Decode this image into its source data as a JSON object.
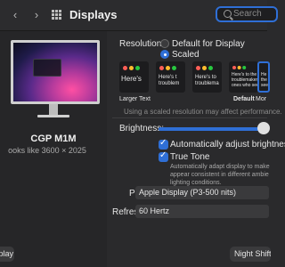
{
  "window": {
    "title": "Displays"
  },
  "toolbar": {
    "back": "‹",
    "forward": "›",
    "search_placeholder": "Search"
  },
  "display": {
    "name": "CGP M1M",
    "resolution_note": "ooks like 3600 × 2025",
    "left_button": "splay"
  },
  "resolution": {
    "label": "Resolution:",
    "option_default": "Default for Display",
    "option_scaled": "Scaled",
    "selected": "Scaled",
    "scales": [
      {
        "text": "Here's",
        "caption": "Larger Text",
        "selected": false
      },
      {
        "text": "Here's t\ntroublem",
        "caption": "",
        "selected": false
      },
      {
        "text": "Here's to\ntroublema",
        "caption": "",
        "selected": false
      },
      {
        "text": "Here's to the\ntroublemaker\nones who see",
        "caption": "Default",
        "selected": false
      },
      {
        "text": "He\nthe\nsee",
        "caption": "Mor",
        "selected": true
      }
    ],
    "note": "Using a scaled resolution may affect performance."
  },
  "brightness": {
    "label": "Brightness:",
    "level": 0.97
  },
  "auto_brightness": {
    "label": "Automatically adjust brightness",
    "checked": true
  },
  "true_tone": {
    "label": "True Tone",
    "checked": true,
    "desc": [
      "Automatically adapt display to make",
      "appear consistent in different ambie",
      "lighting conditions."
    ]
  },
  "presets": {
    "label": "Presets:",
    "value": "Apple Display (P3-500 nits)"
  },
  "refresh_rate": {
    "label": "Refresh Rate:",
    "value": "60 Hertz"
  },
  "night_shift": {
    "label": "Night Shift"
  },
  "colors": {
    "accent": "#2f6fd6",
    "background": "#2a2a2c"
  }
}
